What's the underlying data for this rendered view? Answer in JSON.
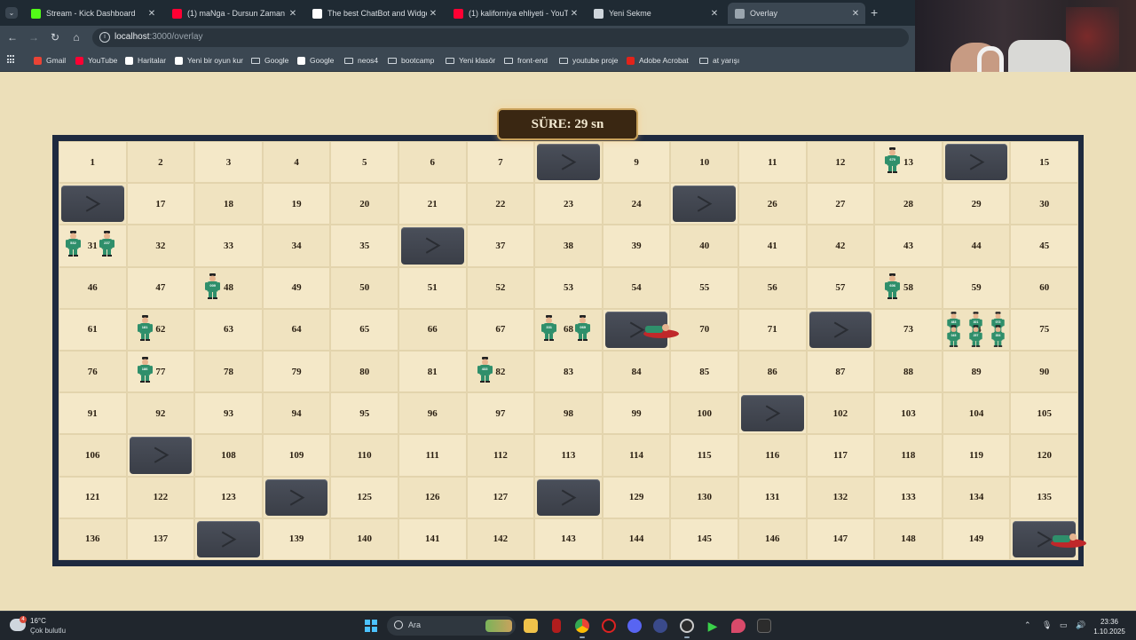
{
  "tabs": [
    {
      "title": "Stream - Kick Dashboard",
      "icon": "kick-icon",
      "color": "#53fc18",
      "active": false
    },
    {
      "title": "(1) maNga - Dursun Zaman",
      "icon": "youtube-icon",
      "color": "#ff0033",
      "active": false
    },
    {
      "title": "The best ChatBot and Widgets",
      "icon": "diamond-icon",
      "color": "#ffffff",
      "active": false
    },
    {
      "title": "(1) kaliforniya ehliyeti - YouTube",
      "icon": "youtube-icon",
      "color": "#ff0033",
      "active": false
    },
    {
      "title": "Yeni Sekme",
      "icon": "chrome-icon",
      "color": "#cfd6dc",
      "active": false
    },
    {
      "title": "Overlay",
      "icon": "globe-icon",
      "color": "#9aa5ae",
      "active": true
    }
  ],
  "address": {
    "host": "localhost",
    "path": ":3000/overlay"
  },
  "bookmarks": [
    {
      "label": "Gmail",
      "type": "app",
      "color": "#ea4335"
    },
    {
      "label": "YouTube",
      "type": "app",
      "color": "#ff0033"
    },
    {
      "label": "Haritalar",
      "type": "app",
      "color": "#ffffff"
    },
    {
      "label": "Yeni bir oyun kur",
      "type": "app",
      "color": "#ffffff"
    },
    {
      "label": "Google",
      "type": "folder"
    },
    {
      "label": "Google",
      "type": "app",
      "color": "#ffffff"
    },
    {
      "label": "neos4",
      "type": "folder"
    },
    {
      "label": "bootcamp",
      "type": "folder"
    },
    {
      "label": "Yeni klasör",
      "type": "folder"
    },
    {
      "label": "front-end",
      "type": "folder"
    },
    {
      "label": "youtube proje",
      "type": "folder"
    },
    {
      "label": "Adobe Acrobat",
      "type": "app",
      "color": "#e2231a"
    },
    {
      "label": "at yarışı",
      "type": "folder"
    }
  ],
  "overlay": {
    "timer": "SÜRE: 29 sn",
    "door_cells": [
      8,
      14,
      16,
      25,
      36,
      69,
      72,
      101,
      107,
      124,
      128,
      138,
      150
    ],
    "players": [
      {
        "cell": 13,
        "id": "670"
      },
      {
        "cell": 31,
        "id": "532"
      },
      {
        "cell": 31,
        "id": "237"
      },
      {
        "cell": 48,
        "id": "009"
      },
      {
        "cell": 58,
        "id": "606"
      },
      {
        "cell": 62,
        "id": "181"
      },
      {
        "cell": 68,
        "id": "331"
      },
      {
        "cell": 68,
        "id": "069"
      },
      {
        "cell": 74,
        "id": "483"
      },
      {
        "cell": 74,
        "id": "301"
      },
      {
        "cell": 74,
        "id": "073"
      },
      {
        "cell": 74,
        "id": "045"
      },
      {
        "cell": 74,
        "id": "257"
      },
      {
        "cell": 74,
        "id": "354"
      },
      {
        "cell": 77,
        "id": "186"
      },
      {
        "cell": 82,
        "id": "433"
      }
    ],
    "eliminated_cells": [
      69,
      150
    ]
  },
  "taskbar": {
    "weather": {
      "temp": "16°C",
      "desc": "Çok bulutlu",
      "badge": "4"
    },
    "search_placeholder": "Ara",
    "time": "23:36",
    "date": "1.10.2025"
  }
}
